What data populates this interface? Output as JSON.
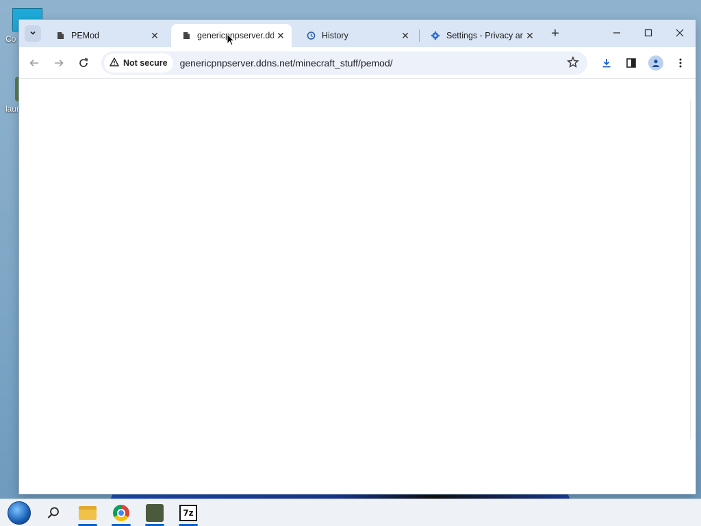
{
  "desktop": {
    "icons": [
      {
        "label": "Co"
      },
      {
        "label": "laun"
      }
    ]
  },
  "browser": {
    "tabs": [
      {
        "title": "PEMod",
        "favicon": "page-icon",
        "active": false
      },
      {
        "title": "genericpnpserver.dd",
        "favicon": "page-icon",
        "active": true
      },
      {
        "title": "History",
        "favicon": "history-icon",
        "active": false
      },
      {
        "title": "Settings - Privacy an",
        "favicon": "gear-icon",
        "active": false
      }
    ],
    "new_tab_label": "+",
    "security_chip": "Not secure",
    "url": "genericpnpserver.ddns.net/minecraft_stuff/pemod/"
  },
  "taskbar": {
    "items": [
      {
        "name": "start-button"
      },
      {
        "name": "search-icon"
      },
      {
        "name": "file-explorer",
        "running": true
      },
      {
        "name": "chrome",
        "running": true
      },
      {
        "name": "minecraft-launcher",
        "running": true
      },
      {
        "name": "7zip",
        "running": true,
        "label": "7z"
      }
    ]
  },
  "colors": {
    "tabstrip": "#dae5f5",
    "omnibox": "#edf1f9",
    "taskbar_indicator": "#0a64c8"
  }
}
